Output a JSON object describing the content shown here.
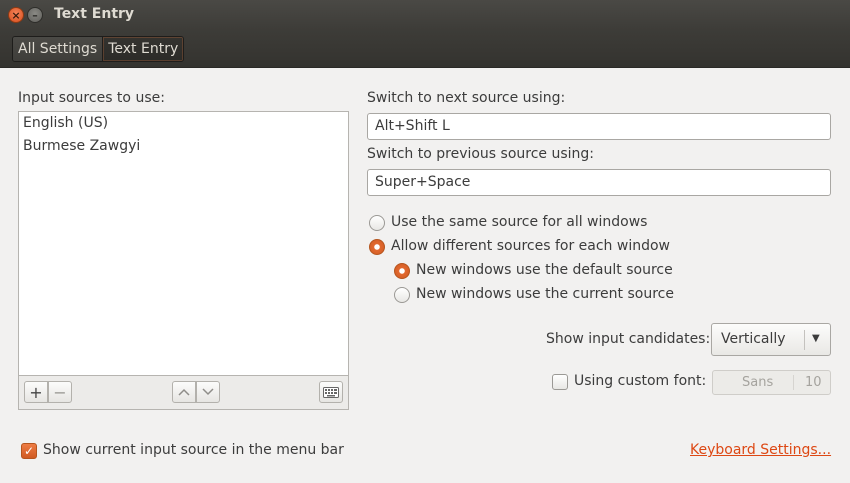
{
  "window": {
    "title": "Text Entry"
  },
  "breadcrumbs": [
    {
      "label": "All Settings"
    },
    {
      "label": "Text Entry"
    }
  ],
  "input_sources": {
    "heading": "Input sources to use:",
    "items": [
      "English (US)",
      "Burmese Zawgyi"
    ],
    "toolbar": {
      "add": "+",
      "remove": "−",
      "up": "⌃",
      "down": "⌄"
    }
  },
  "switching": {
    "next_label": "Switch to next source using:",
    "next_value": "Alt+Shift L",
    "prev_label": "Switch to previous source using:",
    "prev_value": "Super+Space"
  },
  "source_mode": {
    "same_label": "Use the same source for all windows",
    "different_label": "Allow different sources for each window",
    "default_label": "New windows use the default source",
    "current_label": "New windows use the current source",
    "selected": "different",
    "new_window_selected": "default"
  },
  "candidates": {
    "label": "Show input candidates:",
    "value": "Vertically"
  },
  "custom_font": {
    "label": "Using custom font:",
    "checked": false,
    "font_name": "Sans",
    "font_size": "10"
  },
  "menubar": {
    "label": "Show current input source in the menu bar",
    "checked": true
  },
  "keyboard_link": "Keyboard Settings...",
  "colors": {
    "accent": "#dd4814",
    "titlebar": "#3d3c38",
    "background": "#f2f1f0"
  }
}
